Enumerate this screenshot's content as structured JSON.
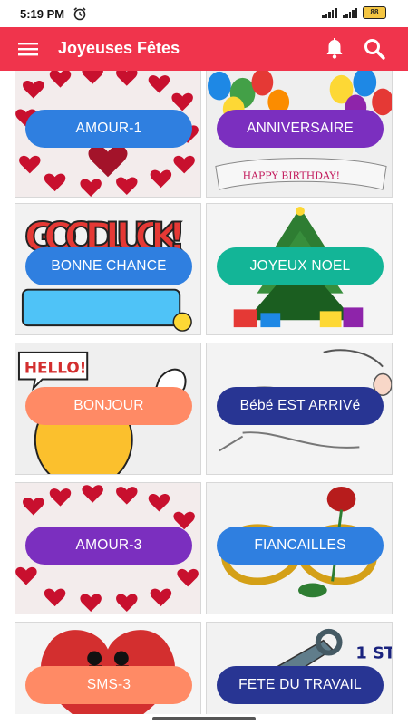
{
  "status_bar": {
    "time": "5:19 PM",
    "battery": "88",
    "icons": [
      "alarm-icon",
      "wifi-icon",
      "signal-icon",
      "battery-icon"
    ]
  },
  "app_bar": {
    "title": "Joyeuses Fêtes",
    "background": "#f0344c",
    "icons": [
      "menu-icon",
      "bell-icon",
      "search-icon"
    ]
  },
  "cards": [
    {
      "label": "AMOUR-1",
      "color": "#2f7fe0",
      "image": "hearts"
    },
    {
      "label": "ANNIVERSAIRE",
      "color": "#7b2fbf",
      "image": "balloons",
      "image_text": "HAPPY BIRTHDAY!"
    },
    {
      "label": "BONNE CHANCE",
      "color": "#2f7fe0",
      "image": "good-luck",
      "image_text": "GOOD LUCK!"
    },
    {
      "label": "JOYEUX NOEL",
      "color": "#13b597",
      "image": "christmas-tree"
    },
    {
      "label": "BONJOUR",
      "color": "#ff8a65",
      "image": "hello-smiley",
      "image_text": "HELLO!"
    },
    {
      "label": "Bébé EST ARRIVé",
      "color": "#283593",
      "image": "stork"
    },
    {
      "label": "AMOUR-3",
      "color": "#7b2fbf",
      "image": "hearts"
    },
    {
      "label": "FIANCAILLES",
      "color": "#2f7fe0",
      "image": "rose-infinity"
    },
    {
      "label": "SMS-3",
      "color": "#ff8a65",
      "image": "couple-heart"
    },
    {
      "label": "FETE DU TRAVAIL",
      "color": "#283593",
      "image": "wrench",
      "image_text": "1 ST"
    }
  ]
}
